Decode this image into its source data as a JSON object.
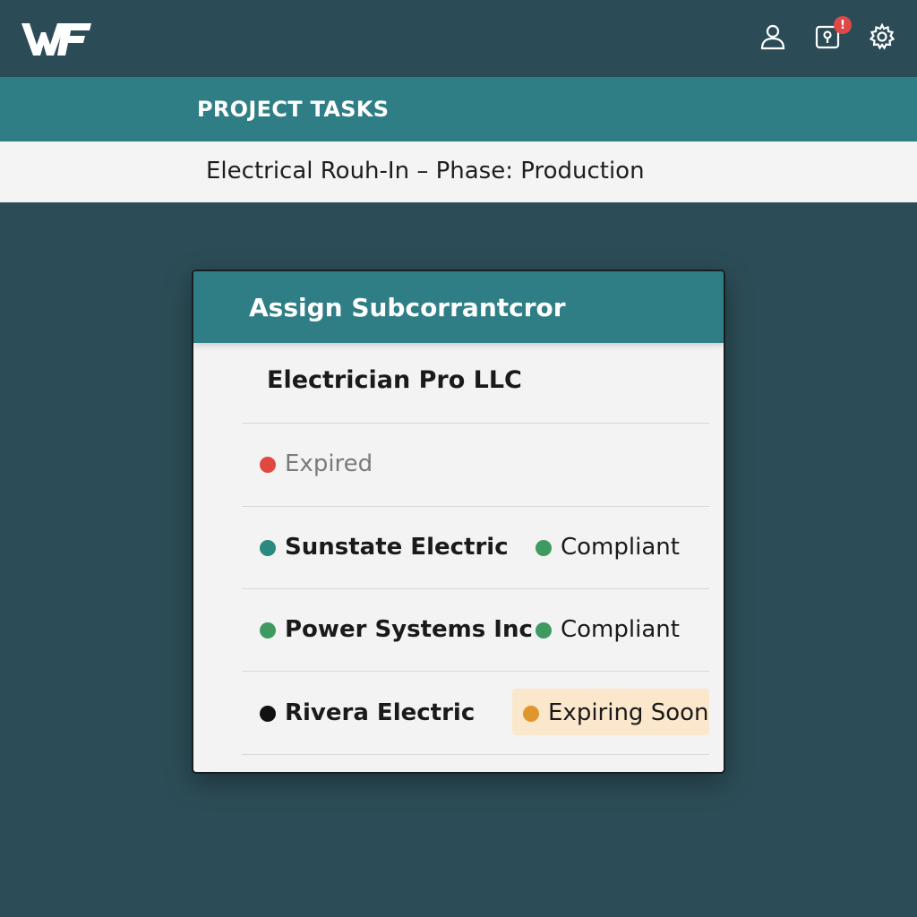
{
  "app": {
    "logo_text": "WF"
  },
  "header": {
    "icons": [
      "user-icon",
      "alert-lock-icon",
      "gear-icon"
    ],
    "notification_badge": "!"
  },
  "section": {
    "title": "PROJECT TASKS"
  },
  "breadcrumb": {
    "text": "Electrical Rouh-In – Phase: Production"
  },
  "modal": {
    "title": "Assign Subcorrantcror",
    "selected": "Electrician Pro LLC",
    "rows": [
      {
        "name": "",
        "status": "Expired",
        "dot_color": "#e0493f",
        "status_dot_color": ""
      },
      {
        "name": "Sunstate Electric",
        "status": "Compliant",
        "dot_color": "#2a8a7e",
        "status_dot_color": "#3f9a61"
      },
      {
        "name": "Power Systems Inc",
        "status": "Compliant",
        "dot_color": "#3f9a61",
        "status_dot_color": "#3f9a61"
      },
      {
        "name": "Rivera Electric",
        "status": "Expiring Soon",
        "dot_color": "#111111",
        "status_dot_color": "#e0962a"
      }
    ]
  },
  "colors": {
    "background": "#2c4d57",
    "accent_teal": "#2f7e86",
    "expired": "#e0493f",
    "compliant": "#3f9a61",
    "expiring": "#e0962a"
  }
}
